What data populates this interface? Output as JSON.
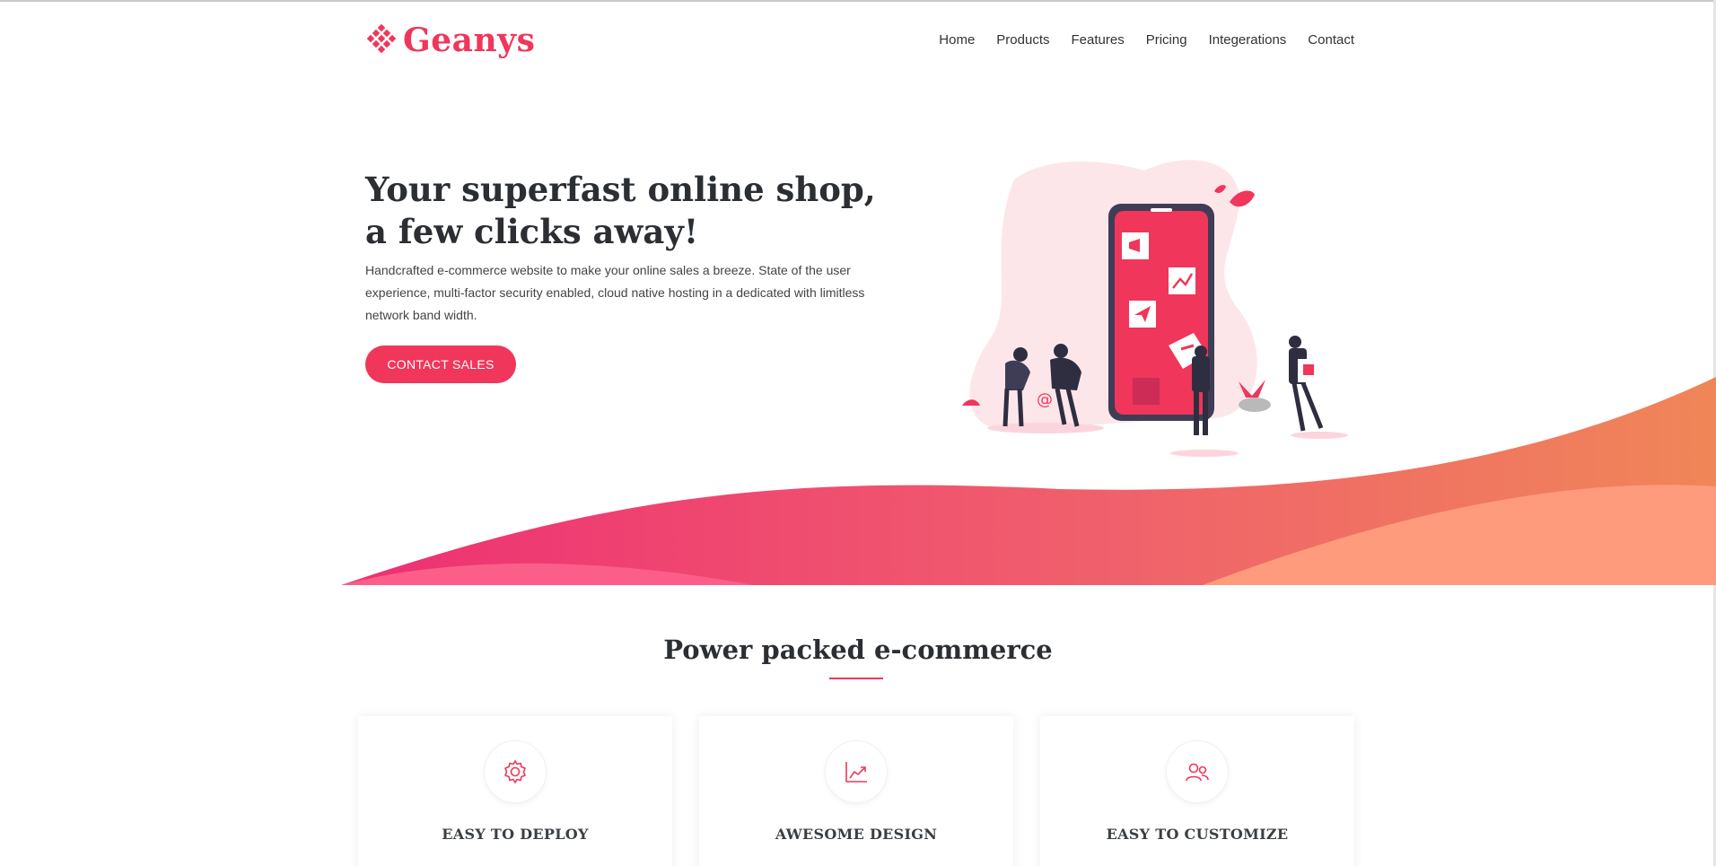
{
  "brand": {
    "name": "Geanys",
    "color": "#f0365a"
  },
  "nav": {
    "items": [
      "Home",
      "Products",
      "Features",
      "Pricing",
      "Integerations",
      "Contact"
    ]
  },
  "hero": {
    "title": "Your superfast online shop, a few clicks away!",
    "description": "Handcrafted e-commerce website to make your online sales a breeze. State of the user experience, multi-factor security enabled, cloud native hosting in a dedicated with limitless network band width.",
    "cta_label": "CONTACT SALES"
  },
  "features": {
    "title": "Power packed e-commerce",
    "cards": [
      {
        "title": "EASY TO DEPLOY",
        "icon": "gear-icon"
      },
      {
        "title": "AWESOME DESIGN",
        "icon": "chart-icon"
      },
      {
        "title": "EASY TO CUSTOMIZE",
        "icon": "users-icon"
      }
    ]
  }
}
